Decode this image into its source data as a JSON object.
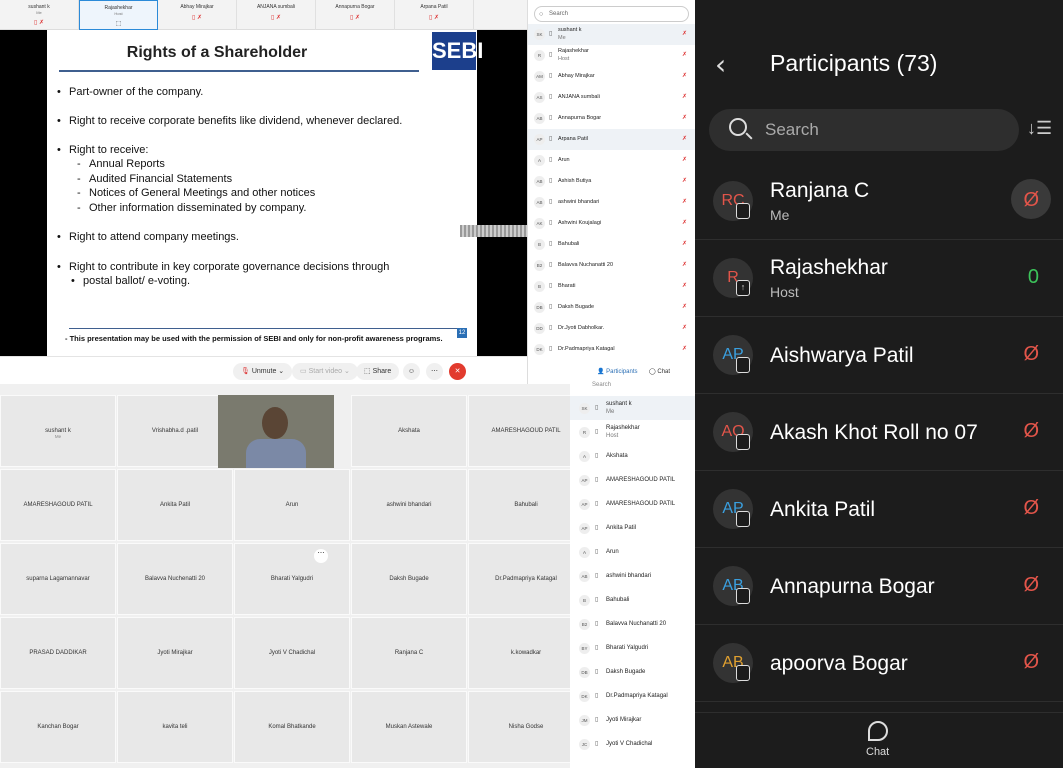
{
  "thumbs": [
    {
      "name": "sushant k",
      "sub": "Me",
      "icon": "mic-off"
    },
    {
      "name": "Rajashekhar",
      "sub": "Host",
      "icon": "share"
    },
    {
      "name": "Abhay Mirajkar",
      "sub": "",
      "icon": "mic-off"
    },
    {
      "name": "ANJANA sumbali",
      "sub": "",
      "icon": "mic-off"
    },
    {
      "name": "Annapurna Bogar",
      "sub": "",
      "icon": "mic-off"
    },
    {
      "name": "Arpana Patil",
      "sub": "",
      "icon": "mic-off"
    }
  ],
  "slide": {
    "title": "Rights of a Shareholder",
    "logo": "SEBI",
    "bullets": [
      "Part-owner of the company.",
      "Right to receive corporate benefits like dividend, whenever declared.",
      "Right to receive:",
      "Right to attend company meetings.",
      "Right to contribute in key corporate governance decisions through",
      "postal ballot/ e-voting."
    ],
    "subitems": [
      "Annual Reports",
      "Audited Financial Statements",
      "Notices of General Meetings and other notices",
      "Other information disseminated by company."
    ],
    "footer": "- This presentation may be used with the permission of SEBI and only for non-profit awareness programs.",
    "page": "12"
  },
  "controls": {
    "unmute": "Unmute",
    "start_video": "Start video",
    "share": "Share",
    "react": "☺",
    "more": "⋯",
    "leave": "✕"
  },
  "plist1": {
    "search": "Search",
    "rows": [
      {
        "av": "SK",
        "name": "sushant k",
        "sub": "Me"
      },
      {
        "av": "R",
        "name": "Rajashekhar",
        "sub": "Host"
      },
      {
        "av": "AM",
        "name": "Abhay Mirajkar"
      },
      {
        "av": "AS",
        "name": "ANJANA sumbali"
      },
      {
        "av": "AB",
        "name": "Annapurna Bogar"
      },
      {
        "av": "AP",
        "name": "Arpana Patil"
      },
      {
        "av": "A",
        "name": "Arun"
      },
      {
        "av": "AB",
        "name": "Ashish Butiya"
      },
      {
        "av": "AB",
        "name": "ashwini bhandari"
      },
      {
        "av": "AK",
        "name": "Ashwini Koujalagi"
      },
      {
        "av": "B",
        "name": "Bahubali"
      },
      {
        "av": "B2",
        "name": "Balavva Nuchanatti 20"
      },
      {
        "av": "B",
        "name": "Bharati"
      },
      {
        "av": "DB",
        "name": "Daksh Bugade"
      },
      {
        "av": "DD",
        "name": "Dr.Jyoti Dabholkar."
      },
      {
        "av": "DK",
        "name": "Dr.Padmapriya Katagal"
      }
    ],
    "tab_participants": "Participants",
    "tab_chat": "Chat"
  },
  "grid": [
    {
      "name": "sushant k",
      "sub": "Me"
    },
    {
      "name": "Vrishabha.d .patil"
    },
    {
      "name": ""
    },
    {
      "name": "Akshata"
    },
    {
      "name": "AMARESHAGOUD PATIL"
    },
    {
      "name": "AMARESHAGOUD PATIL"
    },
    {
      "name": "Ankita Patil"
    },
    {
      "name": "Arun"
    },
    {
      "name": "ashwini bhandari"
    },
    {
      "name": "Bahubali"
    },
    {
      "name": "suparna Lagamannavar"
    },
    {
      "name": "Balavva Nuchenatti 20"
    },
    {
      "name": "Bharati Yalgudri"
    },
    {
      "name": "Daksh Bugade"
    },
    {
      "name": "Dr.Padmapriya Katagal"
    },
    {
      "name": "PRASAD DADDIKAR"
    },
    {
      "name": "Jyoti Mirajkar"
    },
    {
      "name": "Jyoti V Chadichal"
    },
    {
      "name": "Ranjana C"
    },
    {
      "name": "k.kowadkar"
    },
    {
      "name": "Kanchan Bogar"
    },
    {
      "name": "kavita teli"
    },
    {
      "name": "Komal Bhatkande"
    },
    {
      "name": "Muskan Astewale"
    },
    {
      "name": "Nisha Godse"
    }
  ],
  "plist2": {
    "search": "Search",
    "rows": [
      {
        "av": "SK",
        "name": "sushant k",
        "sub": "Me"
      },
      {
        "av": "R",
        "name": "Rajashekhar",
        "sub": "Host"
      },
      {
        "av": "A",
        "name": "Akshata"
      },
      {
        "av": "AP",
        "name": "AMARESHAGOUD PATIL"
      },
      {
        "av": "AP",
        "name": "AMARESHAGOUD PATIL"
      },
      {
        "av": "AP",
        "name": "Ankita Patil"
      },
      {
        "av": "A",
        "name": "Arun"
      },
      {
        "av": "AB",
        "name": "ashwini bhandari"
      },
      {
        "av": "B",
        "name": "Bahubali"
      },
      {
        "av": "B2",
        "name": "Balavva Nuchanatti 20"
      },
      {
        "av": "BY",
        "name": "Bharati Yalgudri"
      },
      {
        "av": "DB",
        "name": "Daksh Bugade"
      },
      {
        "av": "DK",
        "name": "Dr.Padmapriya Katagal"
      },
      {
        "av": "JM",
        "name": "Jyoti Mirajkar"
      },
      {
        "av": "JC",
        "name": "Jyoti V Chadichal"
      }
    ]
  },
  "phone": {
    "back": "‹",
    "title": "Participants (73)",
    "search": "Search",
    "rows": [
      {
        "av": "RC",
        "color": "#e2554a",
        "name": "Ranjana C",
        "role": "Me",
        "mic": "off",
        "highlight": true
      },
      {
        "av": "R",
        "color": "#e2554a",
        "name": "Rajashekhar",
        "role": "Host",
        "mic": "on"
      },
      {
        "av": "AP",
        "color": "#3aa0e0",
        "name": "Aishwarya Patil",
        "role": "",
        "mic": "off"
      },
      {
        "av": "AO",
        "color": "#e2554a",
        "name": "Akash Khot Roll no 07",
        "role": "",
        "mic": "off"
      },
      {
        "av": "AP",
        "color": "#3aa0e0",
        "name": "Ankita Patil",
        "role": "",
        "mic": "off"
      },
      {
        "av": "AB",
        "color": "#3aa0e0",
        "name": "Annapurna Bogar",
        "role": "",
        "mic": "off"
      },
      {
        "av": "AB",
        "color": "#e0a030",
        "name": "apoorva Bogar",
        "role": "",
        "mic": "off"
      }
    ],
    "chat": "Chat"
  }
}
